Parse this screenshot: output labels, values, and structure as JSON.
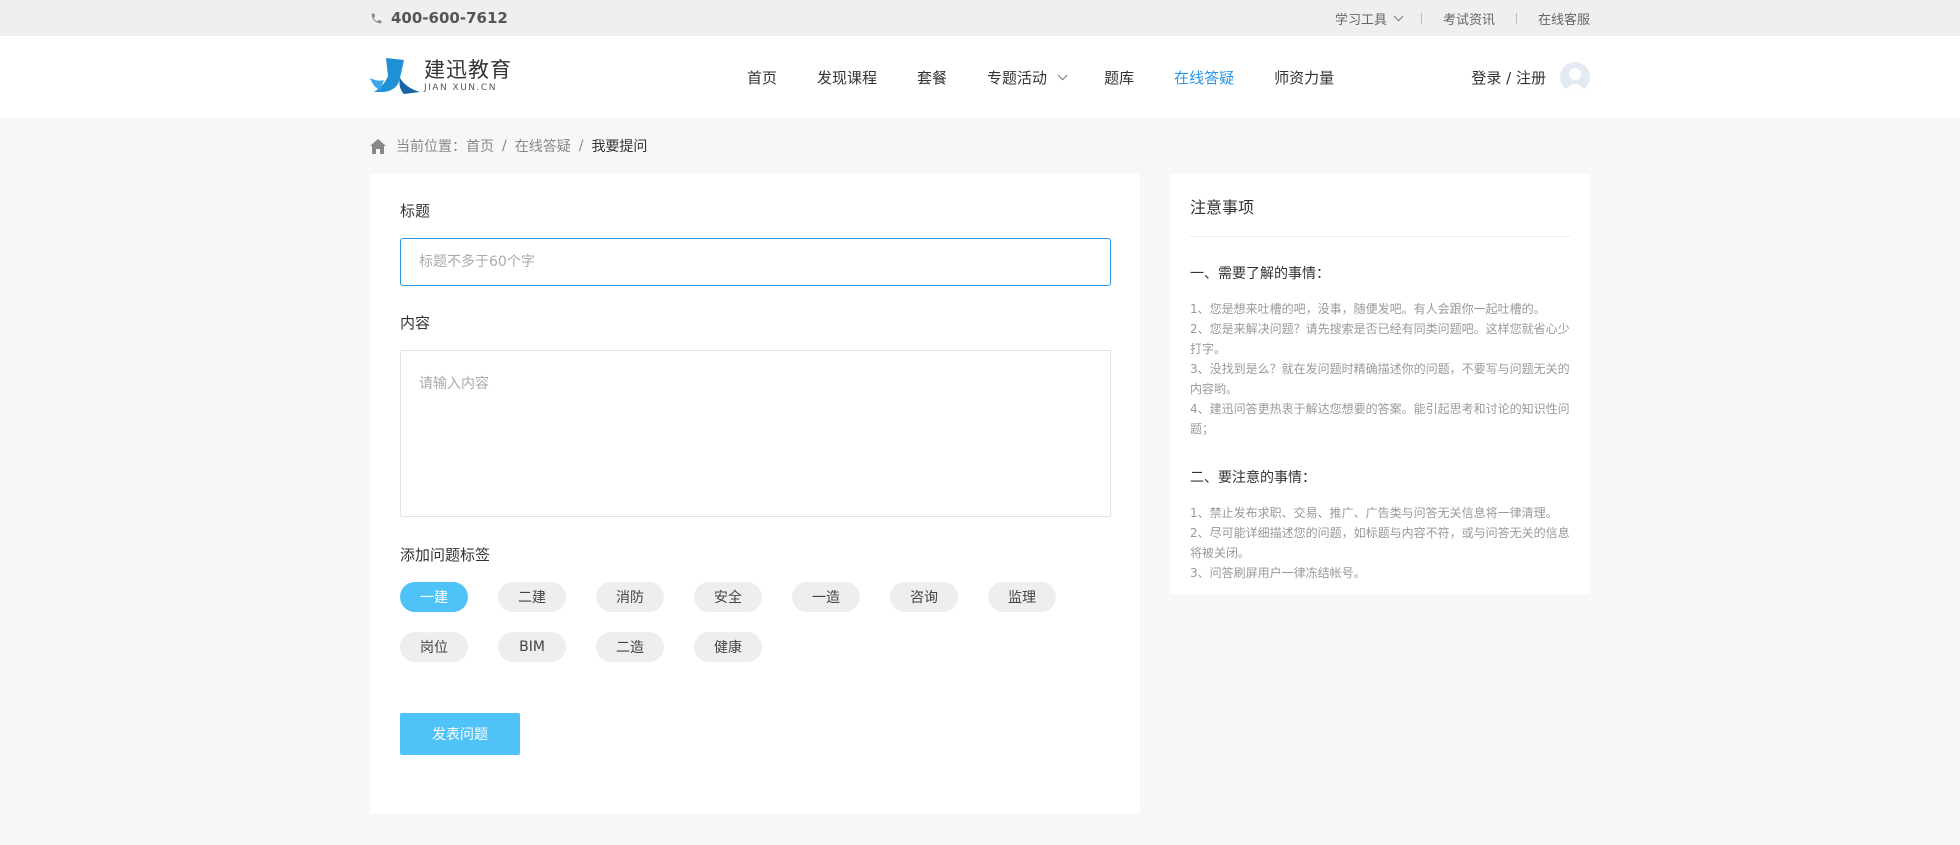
{
  "topbar": {
    "phone": "400-600-7612",
    "links": [
      "学习工具",
      "考试资讯",
      "在线客服"
    ]
  },
  "logo": {
    "cn": "建迅教育",
    "en": "JIAN XUN.CN"
  },
  "nav": {
    "items": [
      "首页",
      "发现课程",
      "套餐",
      "专题活动",
      "题库",
      "在线答疑",
      "师资力量"
    ],
    "active": "在线答疑",
    "login": "登录 / 注册"
  },
  "breadcrumb": {
    "prefix": "当前位置：",
    "home": "首页",
    "section": "在线答疑",
    "current": "我要提问"
  },
  "form": {
    "title_label": "标题",
    "title_placeholder": "标题不多于60个字",
    "content_label": "内容",
    "content_placeholder": "请输入内容",
    "tags_label": "添加问题标签",
    "tags": [
      "一建",
      "二建",
      "消防",
      "安全",
      "一造",
      "咨询",
      "监理",
      "岗位",
      "BIM",
      "二造",
      "健康"
    ],
    "selected_tag": "一建",
    "submit": "发表问题"
  },
  "notes": {
    "title": "注意事项",
    "section1_title": "一、需要了解的事情：",
    "section1_items": [
      "1、您是想来吐槽的吧，没事，随便发吧。有人会跟你一起吐槽的。",
      "2、您是来解决问题？请先搜索是否已经有同类问题吧。这样您就省心少打字。",
      "3、没找到是么？就在发问题时精确描述你的问题，不要写与问题无关的内容哟。",
      "4、建迅问答更热衷于解达您想要的答案。能引起思考和讨论的知识性问题；"
    ],
    "section2_title": "二、要注意的事情：",
    "section2_items": [
      "1、禁止发布求职、交易、推广、广告类与问答无关信息将一律清理。",
      "2、尽可能详细描述您的问题，如标题与内容不符，或与问答无关的信息将被关闭。",
      "3、问答刷屏用户一律冻结帐号。"
    ]
  },
  "colors": {
    "accent": "#2a96e6",
    "tag_selected": "#4fc3f7"
  }
}
